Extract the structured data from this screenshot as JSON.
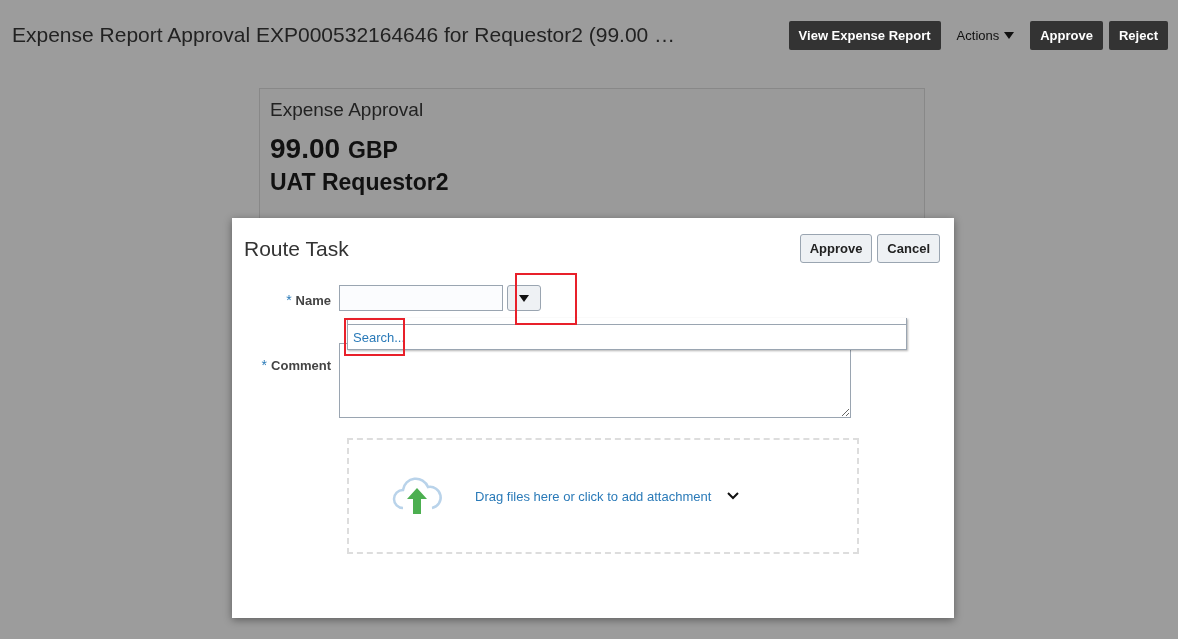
{
  "header": {
    "title": "Expense Report Approval EXP000532164646 for Requestor2 (99.00 …",
    "buttons": [
      {
        "label": "View Expense Report",
        "kind": "button"
      },
      {
        "label": "Actions",
        "kind": "menu"
      },
      {
        "label": "Approve",
        "kind": "button"
      },
      {
        "label": "Reject",
        "kind": "button"
      }
    ]
  },
  "card": {
    "title": "Expense Approval",
    "amount": "99.00",
    "currency": "GBP",
    "requestor": "UAT Requestor2"
  },
  "dialog": {
    "title": "Route Task",
    "buttons": [
      "Approve",
      "Cancel"
    ],
    "fields": [
      {
        "label": "Name",
        "required_mark": "*",
        "kind": "select"
      },
      {
        "label": "Comment",
        "required_mark": "*",
        "kind": "textarea"
      }
    ],
    "dropdown": {
      "option": "Search..."
    },
    "attachment": {
      "text": "Drag files here or click to add attachment"
    }
  }
}
